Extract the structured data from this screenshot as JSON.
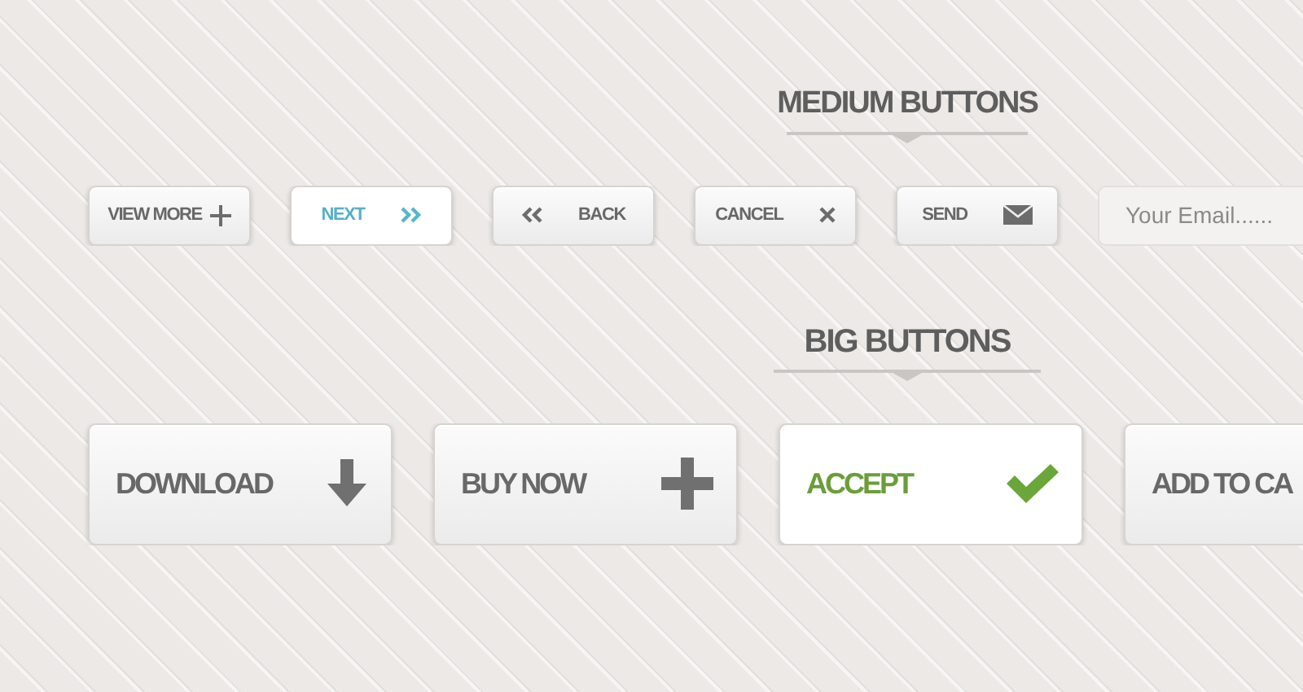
{
  "sections": [
    {
      "title": "MEDIUM BUTTONS",
      "kind": "medium",
      "buttons": [
        {
          "kind": "more",
          "label": "VIEW MORE",
          "highlighted": false
        },
        {
          "kind": "next",
          "label": "NEXT",
          "highlighted": true
        },
        {
          "kind": "back",
          "label": "BACK",
          "highlighted": false
        },
        {
          "kind": "cancel",
          "label": "CANCEL",
          "highlighted": false
        },
        {
          "kind": "send",
          "label": "SEND",
          "highlighted": false
        },
        {
          "kind": "field",
          "placeholder": "Your Email......"
        }
      ]
    },
    {
      "title": "BIG BUTTONS",
      "kind": "big",
      "buttons": [
        {
          "kind": "download",
          "label": "DOWNLOAD",
          "highlighted": false
        },
        {
          "kind": "buy",
          "label": "BUY NOW",
          "highlighted": false
        },
        {
          "kind": "accept",
          "label": "ACCEPT",
          "highlighted": true
        },
        {
          "kind": "cart",
          "label": "ADD TO CA",
          "highlighted": false
        }
      ]
    }
  ]
}
